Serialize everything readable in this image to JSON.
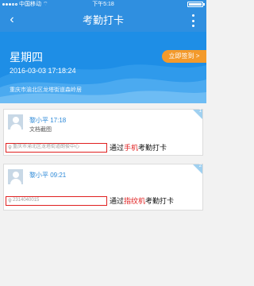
{
  "status_bar": {
    "carrier": "中国移动",
    "time": "下午5:18"
  },
  "header": {
    "title": "考勤打卡"
  },
  "banner": {
    "weekday": "星期四",
    "datetime": "2016-03-03 17:18:24",
    "location": "重庆市渝北区龙塔街道森岭居",
    "signin_label": "立即签到 >"
  },
  "records": [
    {
      "name_time": "黎小平 17:18",
      "subtitle": "文档截图",
      "location_text": "重庆市渝北区龙塔街道朗俊中心",
      "note_prefix": "通过",
      "note_highlight": "手机",
      "note_suffix": "考勤打卡",
      "index": "1"
    },
    {
      "name_time": "黎小平 09:21",
      "subtitle": "",
      "location_text": "2314040015",
      "note_prefix": "通过",
      "note_highlight": "指纹机",
      "note_suffix": "考勤打卡",
      "index": "2"
    }
  ],
  "colors": {
    "header_blue": "#2f8fe0",
    "button_orange": "#f39a2b",
    "highlight_red": "#e02020",
    "name_blue": "#2e8ad8"
  },
  "icons": [
    "back-icon",
    "more-icon",
    "wifi-icon",
    "battery-icon",
    "location-pin-icon",
    "avatar-icon"
  ]
}
